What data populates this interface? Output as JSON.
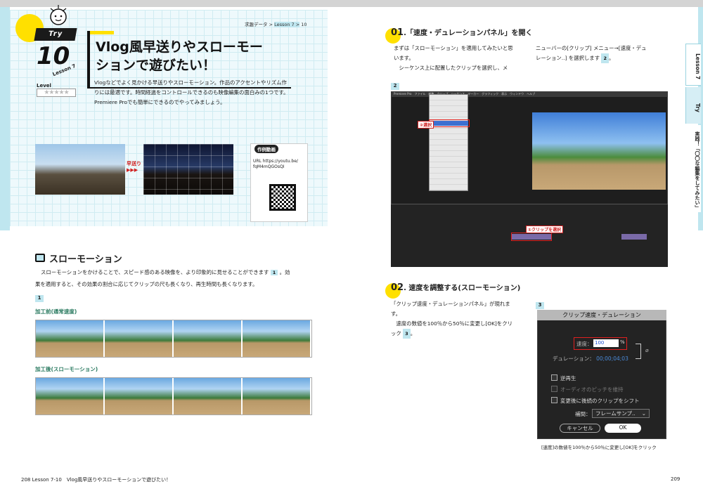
{
  "left_page": {
    "breadcrumb": {
      "part1": "求趣データ >",
      "part2": "Lesson 7 >",
      "part3": "10"
    },
    "badge": "Try",
    "lesson_number": "10",
    "lesson_label": "Lesson 7",
    "level_label": "Level",
    "stars": "★★★★★",
    "title_line1": "Vlog風早送りやスローモー",
    "title_line2": "ションで遊びたい！",
    "intro": [
      "Vlogなどでよく見かける早送りやスローモーション。作品のアクセントやリズム作",
      "りには最適です。時間経過をコントロールできるのも映像編集の面白みの1つです。",
      "Premiere Proでも簡単にできるのでやってみましょう。"
    ],
    "ffwd_label_1": "早送り",
    "ffwd_label_2": "▶▶▶",
    "video_heading": "作例動画",
    "video_url_line1": "URL https://youtu.be/",
    "video_url_line2": "fqM4mQGOsQI",
    "section_title": "スローモーション",
    "section_text_line1": "スローモーションをかけることで、スピード感のある映像を、より印象的に見せることができます",
    "section_text_step": "1",
    "section_text_line1_end": "。効",
    "section_text_line2": "果を適用すると、その効果の割合に応じてクリップの尺も長くなり、再生時間も長くなります。",
    "figure_label": "1",
    "before_label": "加工前(通常速度)",
    "after_label": "加工後(スローモーション)",
    "footer_page": "208",
    "footer_text": "Lesson 7-10　Vlog風早送りやスローモーションで遊びたい！"
  },
  "right_page": {
    "step1_num": "01",
    "step1_title": ".「速度・デュレーションパネル」を開く",
    "step1_text_left": [
      "まずは「スローモーション」を適用してみたいと思",
      "います。",
      "　シーケンス上に配置したクリップを選択し、メ"
    ],
    "step1_text_right": [
      "ニューバーの[クリップ] メニュー→[速度・デュ",
      "レーション..] を選択します"
    ],
    "step1_step_ref": "2",
    "figure2_label": "2",
    "premiere_menu": "Premiere Pro　ファイル　編集　クリップ　シーケンス　マーカー　グラフィック　表示　ウィンドウ　ヘルプ",
    "callout_select2": "②選択",
    "callout_select1": "①クリップを選択",
    "step2_num": "02",
    "step2_title": ". 速度を調整する(スローモーション)",
    "step2_text": [
      "「クリップ速度・デュレーションパネル」が現れま",
      "す。",
      "　速度の数値を100％から50％に変更し[OK]をクリ",
      "ック"
    ],
    "step2_step_ref": "3",
    "figure3_label": "3",
    "dialog": {
      "title": "クリップ速度・デュレーション",
      "speed_label": "速度：",
      "speed_value": "100",
      "speed_unit": "%",
      "duration_label": "デュレーション：",
      "duration_value": "00;00;04;03",
      "reverse_label": "逆再生",
      "pitch_label": "オーディオのピッチを維持",
      "ripple_label": "変更後に後続のクリップをシフト",
      "interp_label": "補間：",
      "interp_value": "フレームサンプ..",
      "cancel_label": "キャンセル",
      "ok_label": "OK"
    },
    "caption": "[速度]の数値を100％から50％に変更し[OK]をクリック",
    "footer_page": "209",
    "side_tab1": "Lesson 7",
    "side_tab2": "Try",
    "side_tab3": "実践！「〇〇な編集をしてみたい」"
  }
}
